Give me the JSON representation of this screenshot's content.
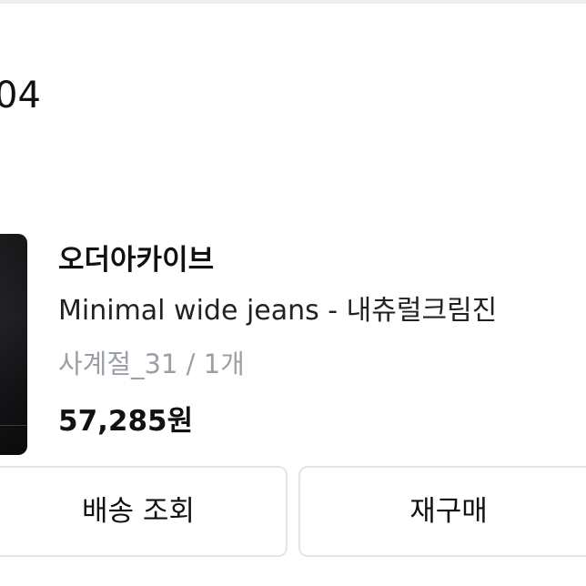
{
  "header": {
    "order_number": "04"
  },
  "order_item": {
    "brand": "오더아카이브",
    "product_name": "Minimal wide jeans - 내츄럴크림진",
    "option": "사계절_31 / 1개",
    "price": "57,285원"
  },
  "actions": {
    "track_label": "배송 조회",
    "reorder_label": "재구매"
  }
}
